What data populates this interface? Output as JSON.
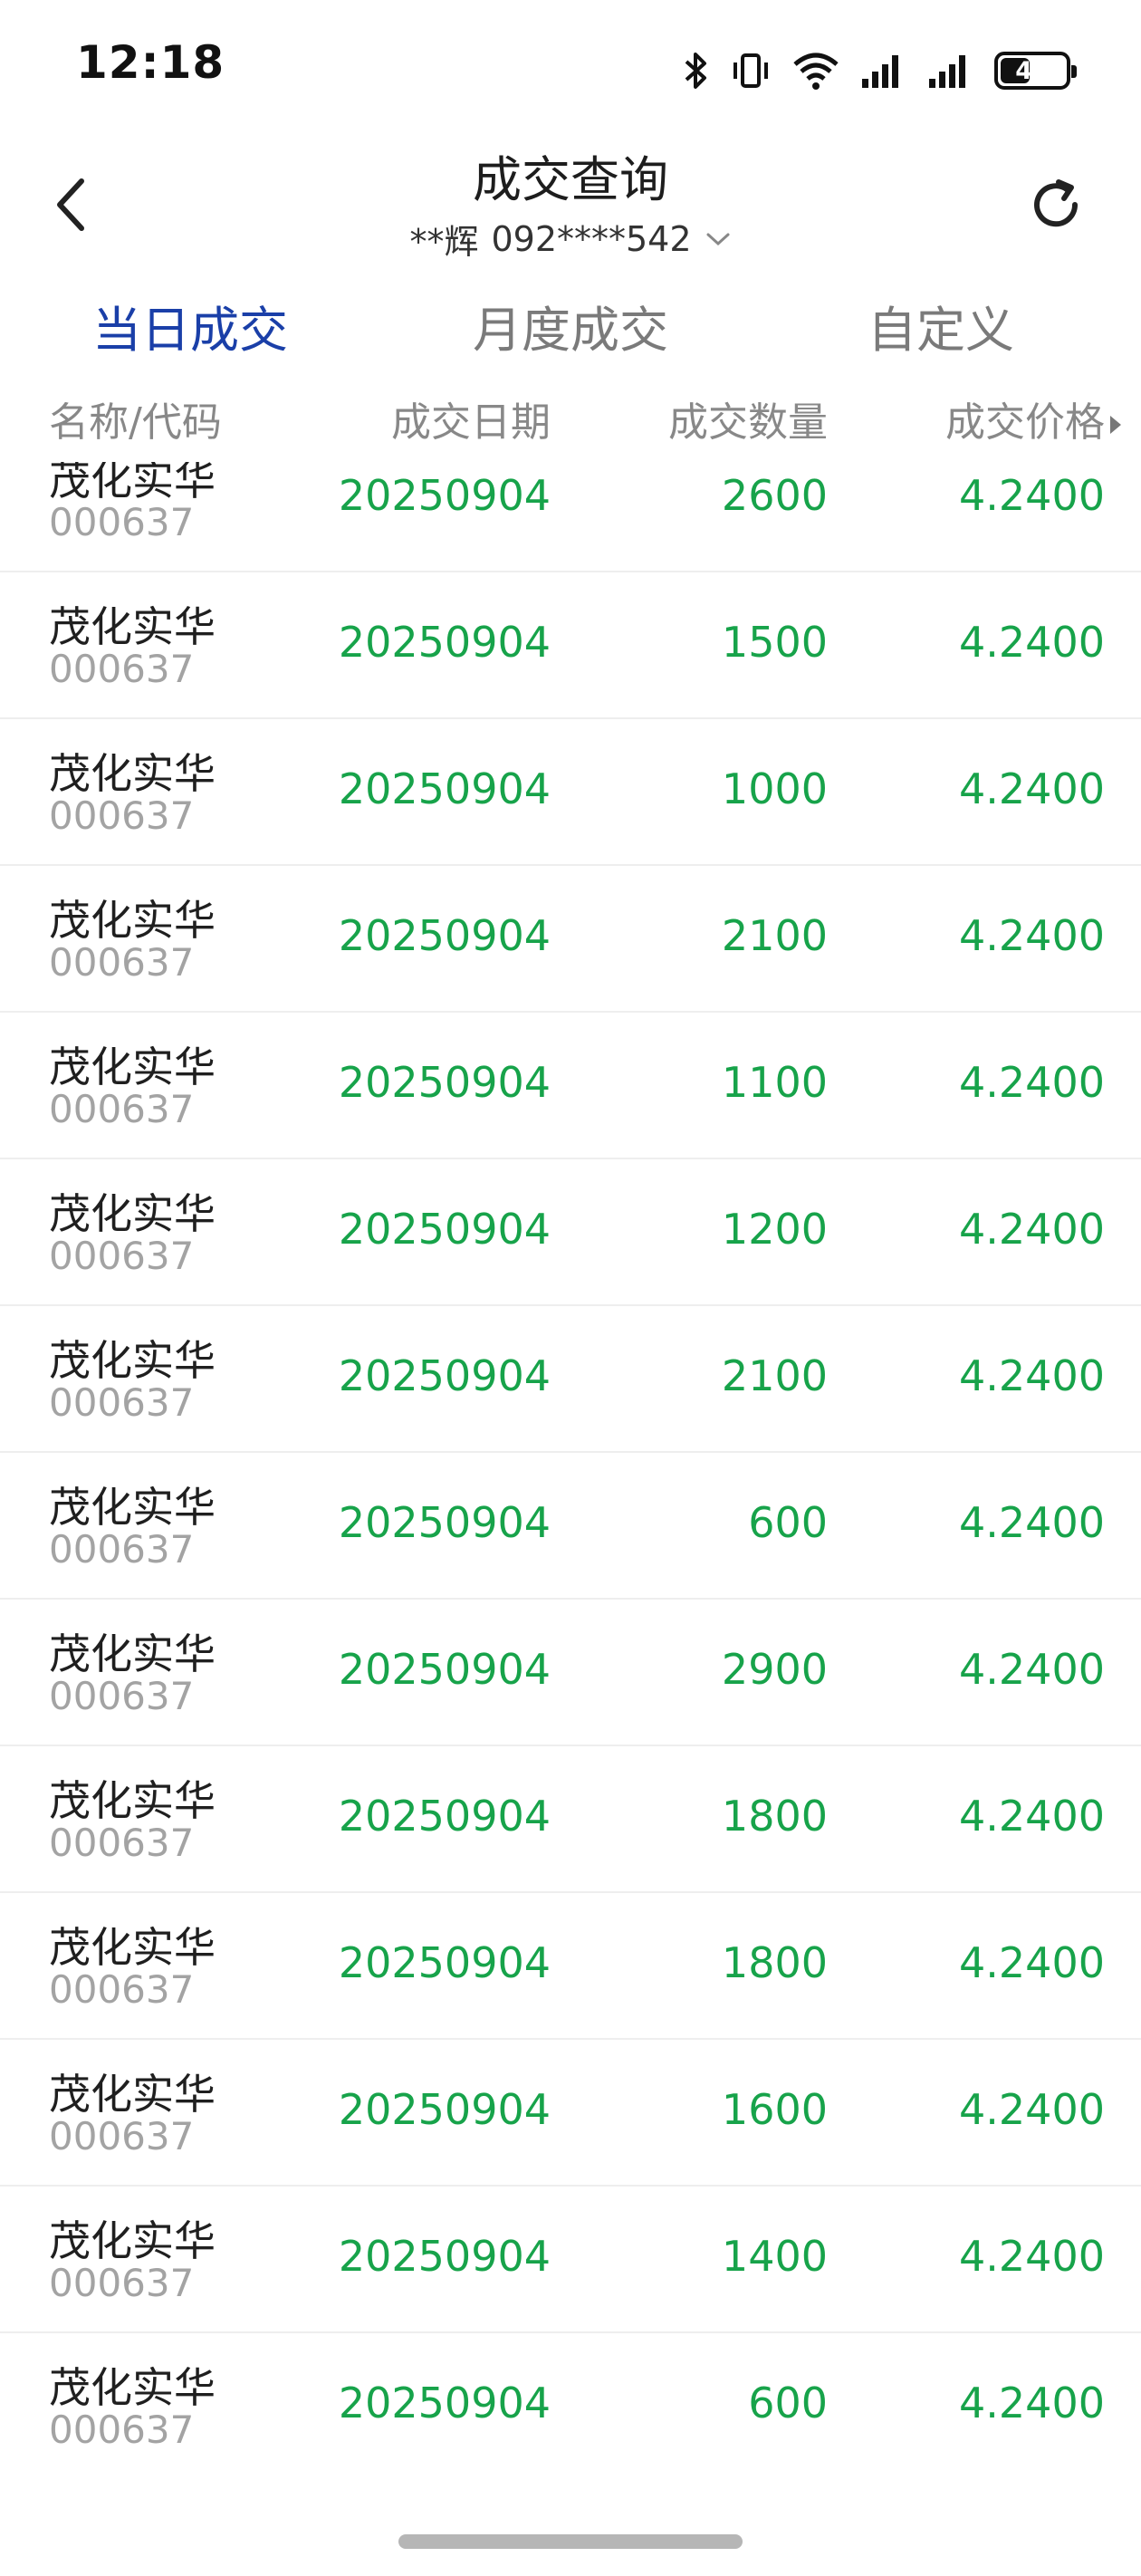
{
  "status_bar": {
    "time": "12:18",
    "icons": [
      "bluetooth-icon",
      "vibrate-icon",
      "wifi-icon",
      "signal-icon",
      "signal-icon"
    ],
    "battery": "45",
    "battery_level": 0.45
  },
  "header": {
    "title": "成交查询",
    "account_name": "**辉",
    "account_number": "092****542",
    "back_icon": "chevron-left-icon",
    "refresh_icon": "refresh-icon",
    "dropdown_icon": "chevron-down-icon"
  },
  "tabs": [
    {
      "label": "当日成交",
      "active": true
    },
    {
      "label": "月度成交",
      "active": false
    },
    {
      "label": "自定义",
      "active": false
    }
  ],
  "table": {
    "columns": [
      "名称/代码",
      "成交日期",
      "成交数量",
      "成交价格"
    ],
    "rows": [
      {
        "name": "茂化实华",
        "code": "000637",
        "date": "20250904",
        "qty": "2600",
        "price": "4.2400"
      },
      {
        "name": "茂化实华",
        "code": "000637",
        "date": "20250904",
        "qty": "1500",
        "price": "4.2400"
      },
      {
        "name": "茂化实华",
        "code": "000637",
        "date": "20250904",
        "qty": "1000",
        "price": "4.2400"
      },
      {
        "name": "茂化实华",
        "code": "000637",
        "date": "20250904",
        "qty": "2100",
        "price": "4.2400"
      },
      {
        "name": "茂化实华",
        "code": "000637",
        "date": "20250904",
        "qty": "1100",
        "price": "4.2400"
      },
      {
        "name": "茂化实华",
        "code": "000637",
        "date": "20250904",
        "qty": "1200",
        "price": "4.2400"
      },
      {
        "name": "茂化实华",
        "code": "000637",
        "date": "20250904",
        "qty": "2100",
        "price": "4.2400"
      },
      {
        "name": "茂化实华",
        "code": "000637",
        "date": "20250904",
        "qty": "600",
        "price": "4.2400"
      },
      {
        "name": "茂化实华",
        "code": "000637",
        "date": "20250904",
        "qty": "2900",
        "price": "4.2400"
      },
      {
        "name": "茂化实华",
        "code": "000637",
        "date": "20250904",
        "qty": "1800",
        "price": "4.2400"
      },
      {
        "name": "茂化实华",
        "code": "000637",
        "date": "20250904",
        "qty": "1800",
        "price": "4.2400"
      },
      {
        "name": "茂化实华",
        "code": "000637",
        "date": "20250904",
        "qty": "1600",
        "price": "4.2400"
      },
      {
        "name": "茂化实华",
        "code": "000637",
        "date": "20250904",
        "qty": "1400",
        "price": "4.2400"
      },
      {
        "name": "茂化实华",
        "code": "000637",
        "date": "20250904",
        "qty": "600",
        "price": "4.2400"
      }
    ]
  },
  "colors": {
    "active_tab": "#1a3fa8",
    "trade_value": "#17a34a",
    "code_text": "#a3a3a3"
  }
}
